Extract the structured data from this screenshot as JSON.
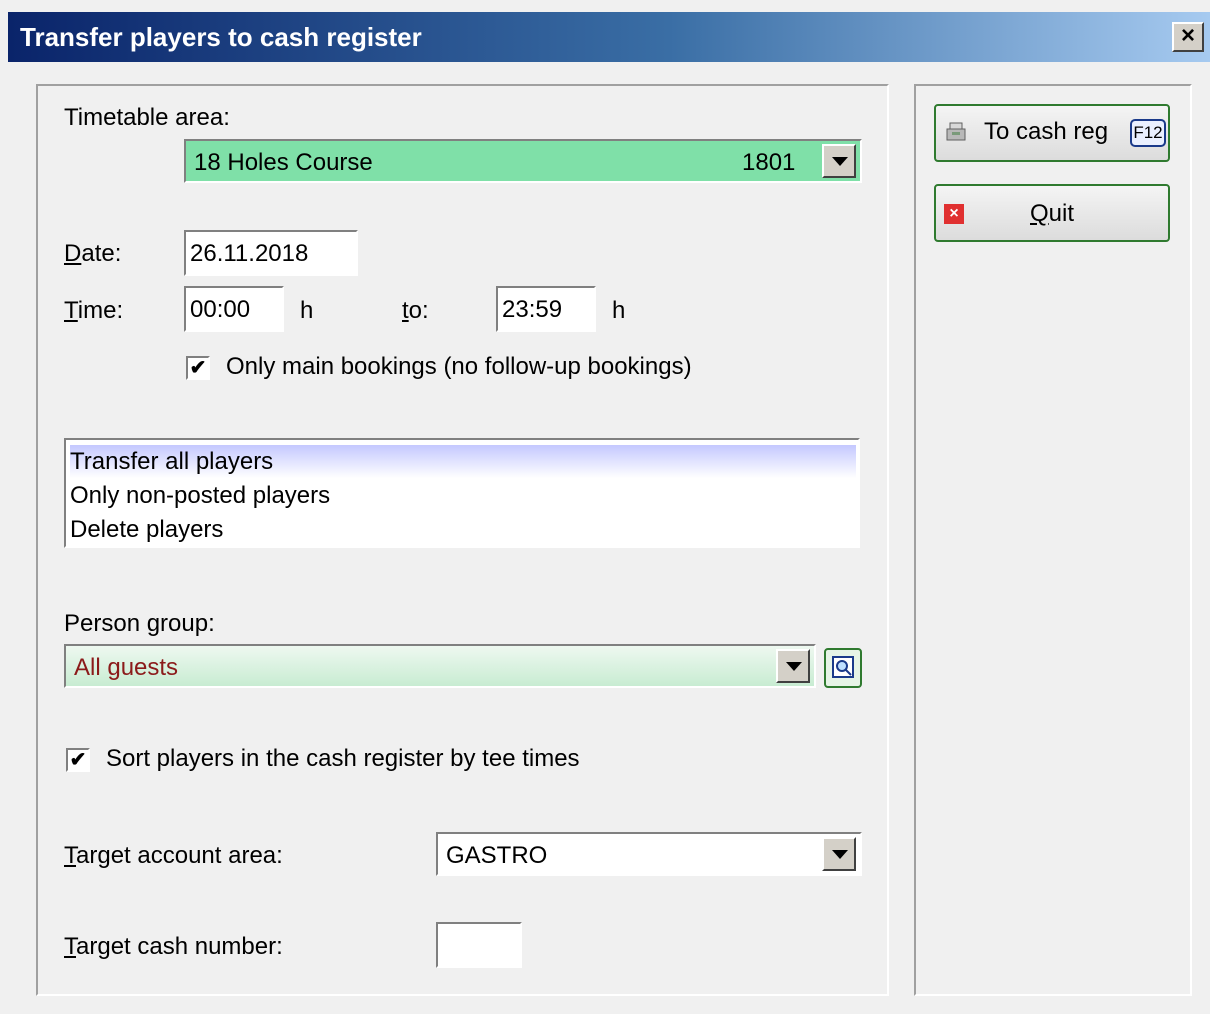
{
  "window": {
    "title": "Transfer players to cash register",
    "close_label": "×"
  },
  "timetable": {
    "label": "Timetable area:",
    "value": "18 Holes Course",
    "code": "1801"
  },
  "date": {
    "label": "Date:",
    "value": "26.11.2018"
  },
  "time": {
    "label": "Time:",
    "from": "00:00",
    "unit": "h",
    "to_label": "to:",
    "to": "23:59",
    "unit2": "h"
  },
  "only_main": {
    "checked": true,
    "label": "Only main bookings (no follow-up bookings)"
  },
  "transfer_options": [
    {
      "label": "Transfer all players",
      "selected": true
    },
    {
      "label": "Only non-posted players",
      "selected": false
    },
    {
      "label": "Delete players",
      "selected": false
    }
  ],
  "person_group": {
    "label": "Person group:",
    "value": "All guests",
    "value_color": "#8b1a1a"
  },
  "sort_by_tee": {
    "checked": true,
    "label": "Sort players in the cash register by tee times"
  },
  "target_account": {
    "label": "Target account area:",
    "value": "GASTRO"
  },
  "target_cash": {
    "label": "Target cash number:",
    "value": ""
  },
  "buttons": {
    "to_cash": {
      "label": "To cash reg",
      "shortcut": "F12",
      "icon": "cash-register-icon"
    },
    "quit": {
      "label": "Quit",
      "icon": "close-icon"
    }
  },
  "colors": {
    "combo_green": "#7fe0a8",
    "group_green": "#d6f0dc",
    "accent_border": "#2f7a2f"
  }
}
